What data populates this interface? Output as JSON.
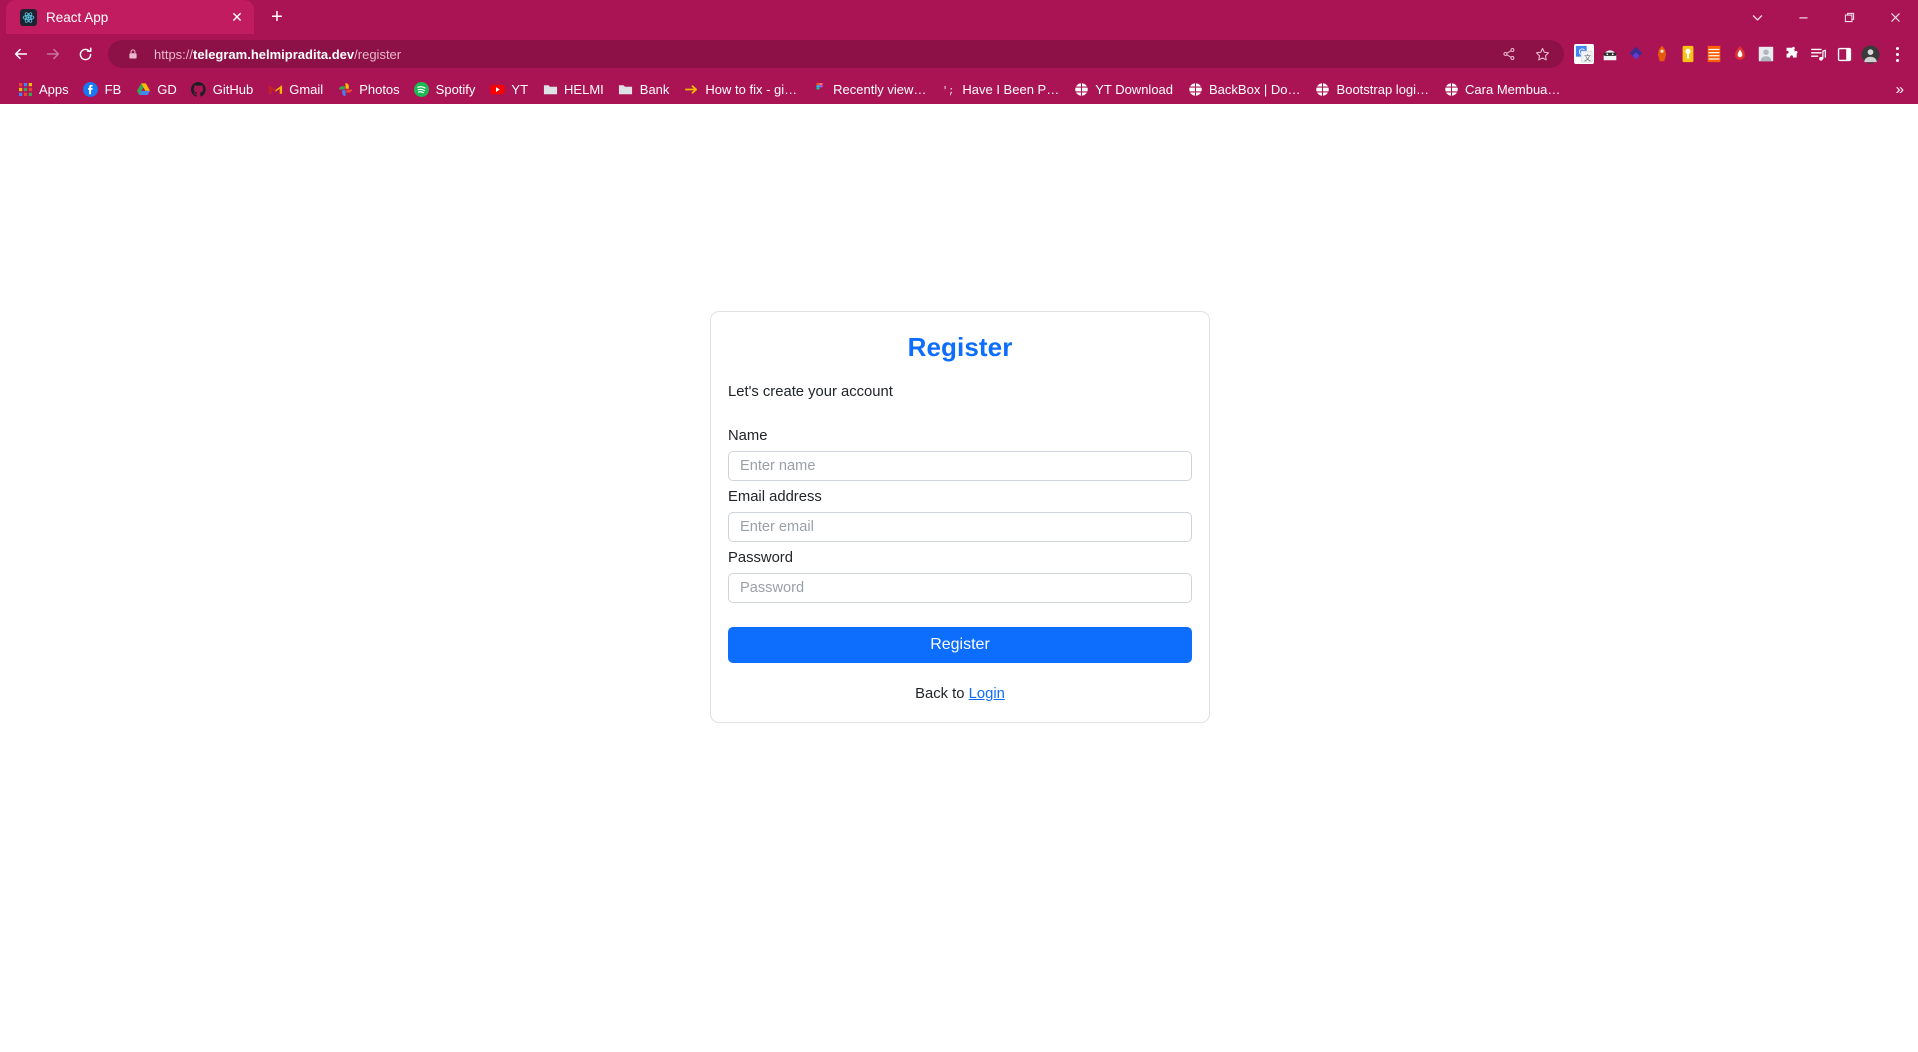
{
  "browser": {
    "theme_color": "#ab1454",
    "tab": {
      "title": "React App",
      "favicon": "react-logo-icon",
      "close_label": "✕"
    },
    "newtab_label": "+",
    "window_controls": [
      {
        "name": "tab-search",
        "glyph": "⌄"
      },
      {
        "name": "minimize",
        "glyph": "—"
      },
      {
        "name": "maximize",
        "glyph": "❐"
      },
      {
        "name": "close",
        "glyph": "✕"
      }
    ],
    "nav": {
      "back": "←",
      "forward": "→",
      "reload": "↻"
    },
    "omnibox": {
      "lock_icon": "padlock-icon",
      "scheme": "https://",
      "host": "telegram.helmipradita.dev",
      "path": "/register",
      "share_icon": "share-icon",
      "bookmark_icon": "star-icon"
    },
    "extensions": [
      {
        "name": "google-translate-extension",
        "color": "#4285f4",
        "glyph": "G"
      },
      {
        "name": "ninja-extension",
        "color": "#f1f3f4",
        "glyph": "◑"
      },
      {
        "name": "blue-diamond-extension",
        "color": "#3b2d8f",
        "glyph": "◆"
      },
      {
        "name": "rocket-extension",
        "color": "#e8590c",
        "glyph": "⚑"
      },
      {
        "name": "keeper-extension",
        "color": "#fcc419",
        "glyph": "●"
      },
      {
        "name": "stripes-extension",
        "color": "#fd5f00",
        "glyph": "≡"
      },
      {
        "name": "opera-drop-extension",
        "color": "#d6336c",
        "glyph": "●"
      },
      {
        "name": "gray-avatar-extension",
        "color": "#adb5bd",
        "glyph": "●"
      },
      {
        "name": "puzzle-extension",
        "color": "#ffffff",
        "glyph": "❖"
      },
      {
        "name": "reading-list-extension",
        "color": "#ffffff",
        "glyph": "≣"
      },
      {
        "name": "sidepanel-extension",
        "color": "#ffffff",
        "glyph": "▯"
      },
      {
        "name": "profile-avatar",
        "color": "#2b2b2b",
        "glyph": "●"
      }
    ],
    "menu_label": "chrome-menu",
    "bookmarks": [
      {
        "label": "Apps",
        "icon": "apps-grid-icon",
        "color": "#ffffff"
      },
      {
        "label": "FB",
        "icon": "facebook-icon",
        "color": "#1877f2"
      },
      {
        "label": "GD",
        "icon": "google-drive-icon",
        "color": "#34a853"
      },
      {
        "label": "GitHub",
        "icon": "github-icon",
        "color": "#ffffff"
      },
      {
        "label": "Gmail",
        "icon": "gmail-icon",
        "color": "#ea4335"
      },
      {
        "label": "Photos",
        "icon": "google-photos-icon",
        "color": "#fbbc04"
      },
      {
        "label": "Spotify",
        "icon": "spotify-icon",
        "color": "#1db954"
      },
      {
        "label": "YT",
        "icon": "youtube-icon",
        "color": "#ff0000"
      },
      {
        "label": "HELMI",
        "icon": "folder-icon",
        "color": "#dee2e6"
      },
      {
        "label": "Bank",
        "icon": "folder-icon",
        "color": "#dee2e6"
      },
      {
        "label": "How to fix - gi…",
        "icon": "arrow-link-icon",
        "color": "#f5b800"
      },
      {
        "label": "Recently view…",
        "icon": "figma-icon",
        "color": "#f24e1e"
      },
      {
        "label": "Have I Been P…",
        "icon": "haveibeenpwned-icon",
        "color": "#dee2e6"
      },
      {
        "label": "YT Download",
        "icon": "globe-icon",
        "color": "#ffffff"
      },
      {
        "label": "BackBox | Do…",
        "icon": "globe-icon",
        "color": "#ffffff"
      },
      {
        "label": "Bootstrap logi…",
        "icon": "globe-icon",
        "color": "#ffffff"
      },
      {
        "label": "Cara Membua…",
        "icon": "globe-icon",
        "color": "#ffffff"
      }
    ],
    "bookmarks_overflow": "»"
  },
  "page": {
    "card": {
      "title": "Register",
      "subtitle": "Let's create your account",
      "title_color": "#0d6efd",
      "fields": [
        {
          "label": "Name",
          "placeholder": "Enter name",
          "value": "",
          "type": "text",
          "name": "name-field"
        },
        {
          "label": "Email address",
          "placeholder": "Enter email",
          "value": "",
          "type": "text",
          "name": "email-field"
        },
        {
          "label": "Password",
          "placeholder": "Password",
          "value": "",
          "type": "password",
          "name": "password-field"
        }
      ],
      "submit_label": "Register",
      "footer_text": "Back to ",
      "footer_link": "Login"
    }
  }
}
